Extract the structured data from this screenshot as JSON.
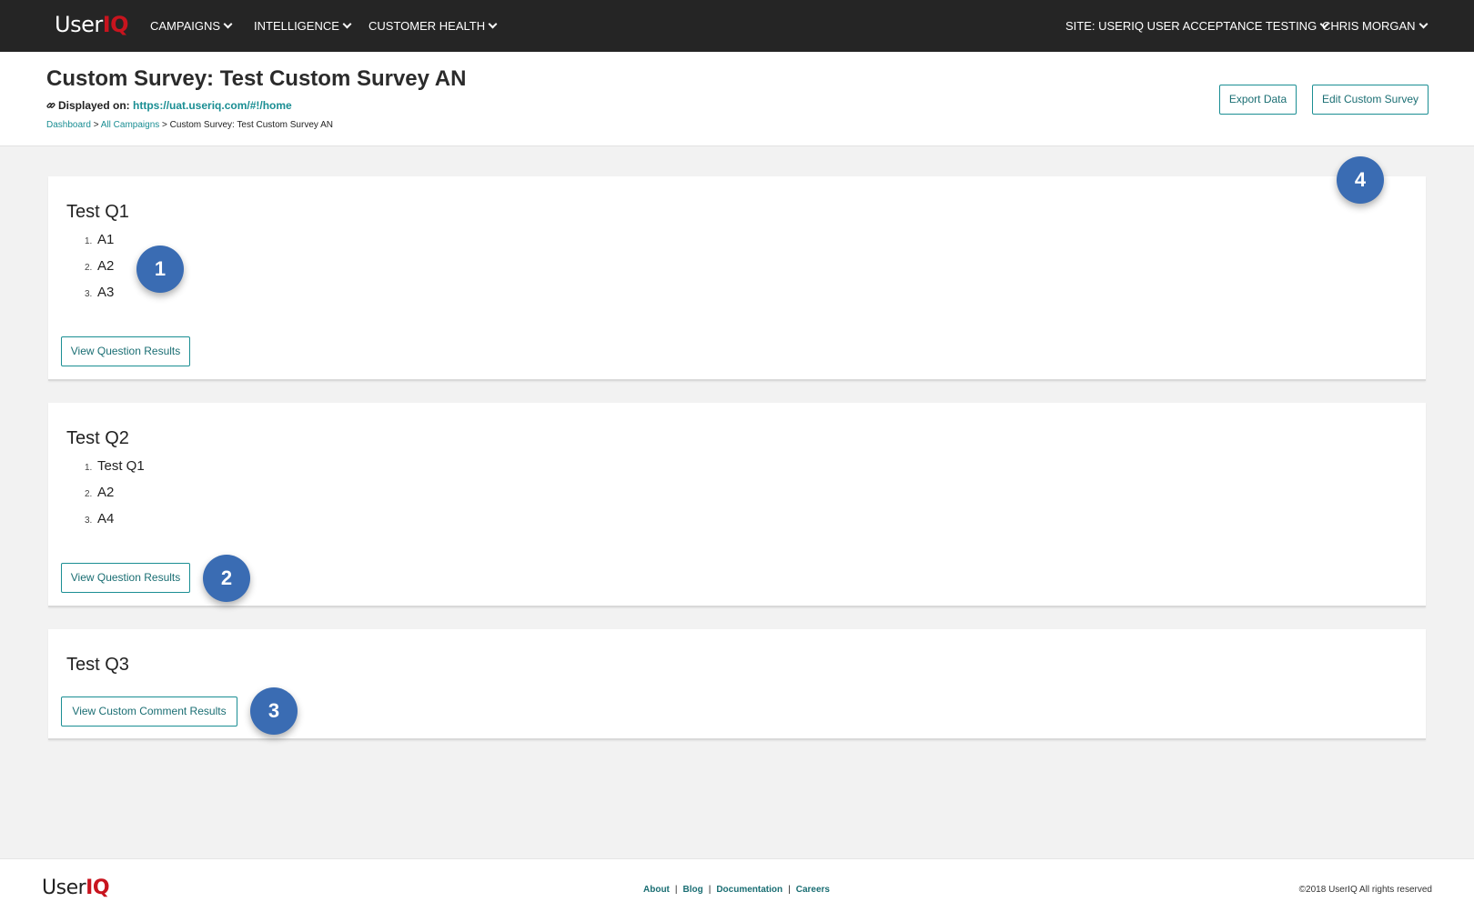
{
  "nav": {
    "logo_part1": "User",
    "logo_part2": "IQ",
    "campaigns": "CAMPAIGNS",
    "intelligence": "INTELLIGENCE",
    "customer_health": "CUSTOMER HEALTH",
    "site": "SITE:  USERIQ USER ACCEPTANCE TESTING",
    "user": "CHRIS MORGAN"
  },
  "header": {
    "title": "Custom Survey: Test Custom Survey AN",
    "displayed_label": "Displayed on:",
    "displayed_url": "https://uat.useriq.com/#!/home",
    "breadcrumb": {
      "dashboard": "Dashboard",
      "sep": ">",
      "all_campaigns": "All Campaigns",
      "current": "Custom Survey: Test Custom Survey AN"
    },
    "export_label": "Export Data",
    "edit_label": "Edit Custom Survey"
  },
  "questions": [
    {
      "title": "Test Q1",
      "answers": [
        "A1",
        "A2",
        "A3"
      ],
      "button": "View Question Results"
    },
    {
      "title": "Test Q2",
      "answers": [
        "Test Q1",
        "A2",
        "A4"
      ],
      "button": "View Question Results"
    },
    {
      "title": "Test Q3",
      "answers": [],
      "button": "View Custom Comment Results"
    }
  ],
  "list_numbers": [
    "1.",
    "2.",
    "3."
  ],
  "callouts": [
    "1",
    "2",
    "3",
    "4"
  ],
  "footer": {
    "logo_part1": "User",
    "logo_part2": "IQ",
    "links": [
      "About",
      "Blog",
      "Documentation",
      "Careers"
    ],
    "separator": "|",
    "copyright": "©2018 UserIQ All rights reserved"
  },
  "colors": {
    "accent": "#1a8e93",
    "brand_red": "#c8141e",
    "nav_bg": "#252525",
    "callout": "#3a6cb3"
  }
}
